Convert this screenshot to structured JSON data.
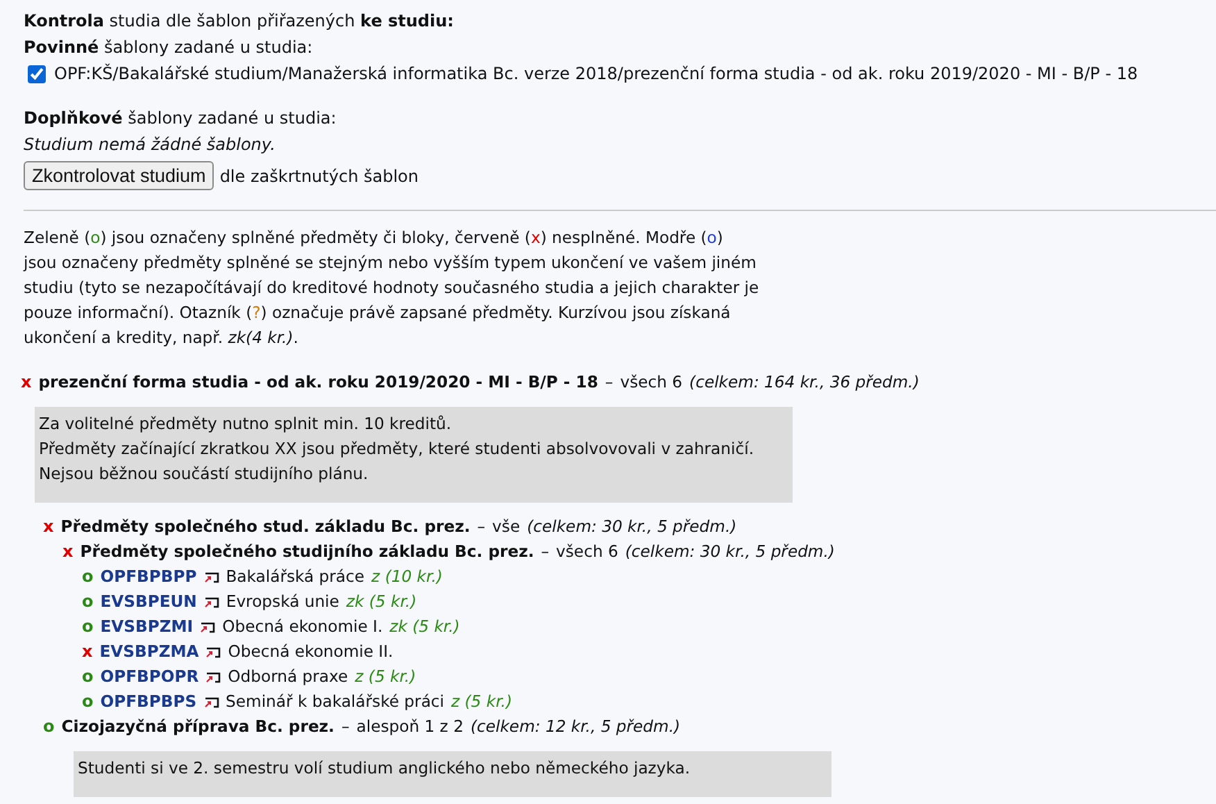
{
  "header": {
    "title": "**Kontrola** studia dle šablon přiřazených **ke studiu:**",
    "mandatory_label": "**Povinné** šablony zadané u studia:",
    "templates": [
      {
        "label": "OPF:KŠ/Bakalářské studium/Manažerská informatika Bc. verze 2018/prezenční forma studia - od ak. roku 2019/2020 - MI - B/P - 18",
        "checked": true
      }
    ],
    "supplementary_label": "**Doplňkové** šablony zadané u studia:",
    "no_templates": "Studium nemá žádné šablony.",
    "check_button": "Zkontrolovat studium",
    "check_button_suffix": "dle zaškrtnutých šablon"
  },
  "legend": [
    {
      "kind": "text",
      "text": "Zeleně ("
    },
    {
      "kind": "passed",
      "text": "o"
    },
    {
      "kind": "text",
      "text": ") jsou označeny splněné předměty či bloky, červeně ("
    },
    {
      "kind": "failed",
      "text": "x"
    },
    {
      "kind": "text",
      "text": ") nesplněné. Modře ("
    },
    {
      "kind": "other",
      "text": "o"
    },
    {
      "kind": "text",
      "text": ") jsou označeny předměty splněné se stejným nebo vyšším typem ukončení ve vašem jiném studiu (tyto se nezapočítávají do kreditové hodnoty současného studia a jejich charakter je pouze informační). Otazník ("
    },
    {
      "kind": "enrolled",
      "text": "?"
    },
    {
      "kind": "text",
      "text": ") označuje právě zapsané předměty. Kurzívou jsou získaná ukončení a kredity, např. "
    },
    {
      "kind": "italic",
      "text": "zk(4 kr.)"
    },
    {
      "kind": "text",
      "text": "."
    }
  ],
  "tree": [
    {
      "kind": "block",
      "passed": false,
      "mark": "x",
      "title": "prezenční forma studia - od ak. roku 2019/2020 - MI - B/P - 18",
      "separator": "–",
      "requirement": "všech 6",
      "summary": "(celkem: 164 kr., 36 předm.)",
      "note": [
        "Za volitelné předměty nutno splnit min. 10 kreditů.",
        "Předměty začínající zkratkou XX jsou předměty, které studenti absolvovovali v zahraničí.",
        "Nejsou běžnou součástí studijního plánu."
      ],
      "children": [
        {
          "kind": "block",
          "passed": false,
          "mark": "x",
          "title": "Předměty společného stud. základu Bc. prez.",
          "separator": "–",
          "requirement": "vše",
          "summary": "(celkem: 30 kr., 5 předm.)",
          "children": [
            {
              "kind": "block",
              "passed": false,
              "mark": "x",
              "title": "Předměty společného studijního základu Bc. prez.",
              "separator": "–",
              "requirement": "všech 6",
              "summary": "(celkem: 30 kr., 5 předm.)",
              "children": [
                {
                  "kind": "course",
                  "passed": true,
                  "mark": "o",
                  "code": "OPFBPBPP",
                  "name": "Bakalářská práce",
                  "result": "z (10 kr.)"
                },
                {
                  "kind": "course",
                  "passed": true,
                  "mark": "o",
                  "code": "EVSBPEUN",
                  "name": "Evropská unie",
                  "result": "zk (5 kr.)"
                },
                {
                  "kind": "course",
                  "passed": true,
                  "mark": "o",
                  "code": "EVSBPZMI",
                  "name": "Obecná ekonomie I.",
                  "result": "zk (5 kr.)"
                },
                {
                  "kind": "course",
                  "passed": false,
                  "mark": "x",
                  "code": "EVSBPZMA",
                  "name": "Obecná ekonomie II."
                },
                {
                  "kind": "course",
                  "passed": true,
                  "mark": "o",
                  "code": "OPFBPOPR",
                  "name": "Odborná praxe",
                  "result": "z (5 kr.)"
                },
                {
                  "kind": "course",
                  "passed": true,
                  "mark": "o",
                  "code": "OPFBPBPS",
                  "name": "Seminář k bakalářské práci",
                  "result": "z (5 kr.)"
                }
              ]
            }
          ]
        },
        {
          "kind": "block",
          "passed": true,
          "mark": "o",
          "title": "Cizojazyčná příprava Bc. prez.",
          "separator": "–",
          "requirement": "alespoň 1 z 2",
          "summary": "(celkem: 12 kr., 5 předm.)",
          "note": [
            "Studenti si ve 2. semestru volí studium anglického nebo německého jazyka."
          ]
        }
      ]
    }
  ]
}
